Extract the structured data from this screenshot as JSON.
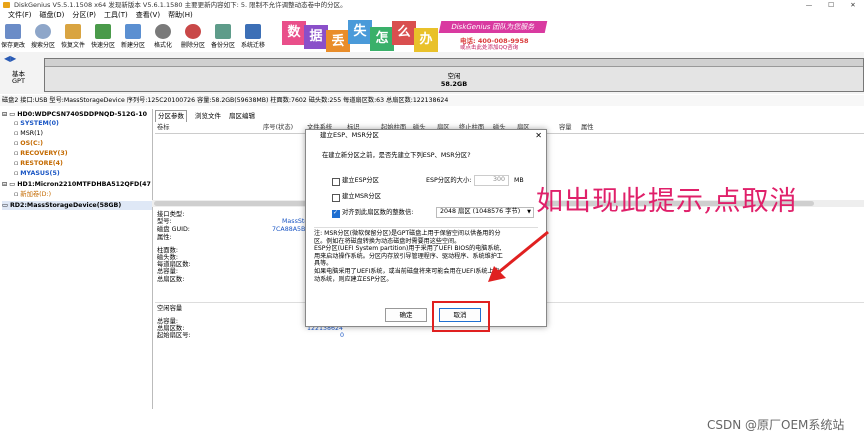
{
  "titlebar": {
    "text": "DiskGenius V5.5.1.1508 x64   发现新版本 V5.6.1.1580  主要更新内容如下: 5. 限制不允许调整动态卷中的分区。"
  },
  "menu": [
    "文件(F)",
    "磁盘(D)",
    "分区(P)",
    "工具(T)",
    "查看(V)",
    "帮助(H)"
  ],
  "toolbar": [
    "保存更改",
    "搜索分区",
    "恢复文件",
    "快速分区",
    "新建分区",
    "格式化",
    "删除分区",
    "备份分区",
    "系统迁移"
  ],
  "banner": {
    "chars": [
      "数",
      "据",
      "丢",
      "失",
      "怎",
      "么",
      "办"
    ],
    "brand": "DiskGenius 团队为您服务",
    "phone": "电话: 400-008-9958",
    "qq": "或点击此处添加QQ咨询"
  },
  "diskbar": {
    "type": "基本",
    "scheme": "GPT",
    "part_label": "空闲",
    "part_size": "58.2GB"
  },
  "infoline": "磁盘2 接口:USB  型号:MassStorageDevice  序列号:125C20100726  容量:58.2GB(59638MB)  柱面数:7602  磁头数:255  每道扇区数:63  总扇区数:122138624",
  "tree": [
    {
      "text": "HD0:WDPCSN740SDDPNQD-512G-10",
      "color": "#000000",
      "bold": true
    },
    {
      "text": "SYSTEM(0)",
      "color": "#1a56c4",
      "bold": true
    },
    {
      "text": "MSR(1)",
      "color": "#000000",
      "bold": false
    },
    {
      "text": "OS(C:)",
      "color": "#c46a00",
      "bold": true
    },
    {
      "text": "RECOVERY(3)",
      "color": "#c46a00",
      "bold": true
    },
    {
      "text": "RESTORE(4)",
      "color": "#c46a00",
      "bold": true
    },
    {
      "text": "MYASUS(5)",
      "color": "#1a56c4",
      "bold": true
    },
    {
      "text": "HD1:Micron2210MTFDHBA512QFD(47",
      "color": "#000000",
      "bold": true
    },
    {
      "text": "新加卷(D:)",
      "color": "#c46a00",
      "bold": false
    },
    {
      "text": "RD2:MassStorageDevice(58GB)",
      "color": "#000000",
      "bold": true
    }
  ],
  "tabs": [
    "分区参数",
    "浏览文件",
    "扇区编辑"
  ],
  "columns": [
    "卷标",
    "序号(状态)",
    "文件系统",
    "标识",
    "起始柱面",
    "磁头",
    "扇区",
    "终止柱面",
    "磁头",
    "扇区",
    "容量",
    "属性"
  ],
  "props_top": [
    {
      "label": "接口类型:",
      "value": ""
    },
    {
      "label": "型号:",
      "value": "MassStora"
    },
    {
      "label": "磁盘 GUID:",
      "value": "7CA88A5B-6"
    },
    {
      "label": "属性:",
      "value": ""
    },
    {
      "label": "",
      "value": ""
    },
    {
      "label": "柱面数:",
      "value": ""
    },
    {
      "label": "磁头数:",
      "value": ""
    },
    {
      "label": "每道扇区数:",
      "value": ""
    },
    {
      "label": "总容量:",
      "value": ""
    },
    {
      "label": "总扇区数:",
      "value": "12"
    }
  ],
  "props_bottom": [
    {
      "label": "空闲容量",
      "value": ""
    },
    {
      "label": "",
      "value": ""
    },
    {
      "label": "总容量:",
      "value": ""
    },
    {
      "label": "总扇区数:",
      "value": "122138624"
    },
    {
      "label": "起始扇区号:",
      "value": "0"
    }
  ],
  "dialog": {
    "title": "建立ESP、MSR分区",
    "prompt": "在建立新分区之前，是否先建立下列ESP、MSR分区?",
    "esp_label": "建立ESP分区",
    "esp_size_label": "ESP分区的大小:",
    "esp_size_value": "300",
    "esp_size_unit": "MB",
    "msr_label": "建立MSR分区",
    "align_label": "对齐到此扇区数的整数倍:",
    "align_value": "2048 扇区 (1048576 字节)",
    "note": [
      "注: MSR分区(微软保留分区)是GPT磁盘上用于保留空间以供备用的分",
      "区。例如在将磁盘转换为动态磁盘时需要用这些空间。",
      "    ESP分区(UEFI System partition)用于采用了UEFI BIOS的电脑系统,",
      "用来启动操作系统。分区内存放引导管理程序、驱动程序、系统维护工",
      "具等。",
      "    如果电脑采用了UEFI系统，或当前磁盘将来可能会用在UEFI系统上启",
      "动系统，则应建立ESP分区。"
    ],
    "ok_label": "确定",
    "cancel_label": "取消"
  },
  "annotation": {
    "text": "如出现此提示,点取消",
    "color": "#e0206a"
  },
  "watermark": "CSDN @原厂OEM系统站"
}
